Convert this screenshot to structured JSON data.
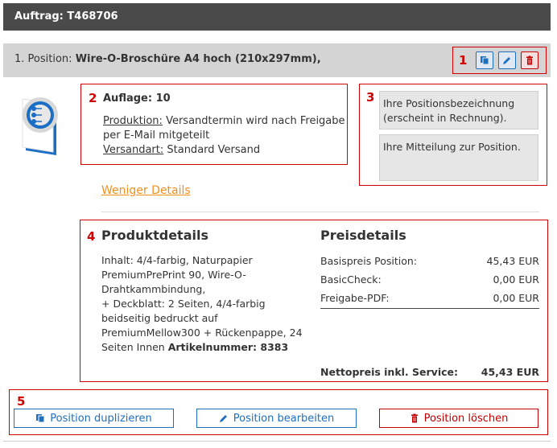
{
  "header": {
    "title": "Auftrag: T468706"
  },
  "position": {
    "prefix": "1. Position:",
    "name": "Wire-O-Broschüre A4 hoch (210x297mm),"
  },
  "annotations": {
    "n1": "1",
    "n2": "2",
    "n3": "3",
    "n4": "4",
    "n5": "5"
  },
  "summary": {
    "auflage": "Auflage: 10",
    "produktion_label": "Produktion:",
    "produktion_value": " Versandtermin wird nach Freigabe",
    "produktion_value2": "per E-Mail mitgeteilt",
    "versandart_label": "Versandart:",
    "versandart_value": " Standard Versand"
  },
  "notes": {
    "position_name_line1": "Ihre Positionsbezeichnung",
    "position_name_line2": "(erscheint in Rechnung).",
    "message": "Ihre Mitteilung zur Position."
  },
  "less_details_link": "Weniger Details",
  "produktdetails": {
    "heading": "Produktdetails",
    "lines": [
      "Inhalt: 4/4-farbig, Naturpapier",
      "PremiumPrePrint 90, Wire-O-",
      "Drahtkammbindung,",
      "+ Deckblatt: 2 Seiten, 4/4-farbig",
      "beidseitig bedruckt auf",
      "PremiumMellow300 + Rückenpappe, 24"
    ],
    "last_line_prefix": "Seiten Innen ",
    "artikel_label": "Artikelnummer: 8383"
  },
  "preisdetails": {
    "heading": "Preisdetails",
    "rows": [
      {
        "label": "Basispreis Position:",
        "value": "45,43 EUR"
      },
      {
        "label": "BasicCheck:",
        "value": "0,00 EUR"
      },
      {
        "label": "Freigabe-PDF:",
        "value": "0,00 EUR"
      }
    ],
    "total_label": "Nettopreis inkl. Service:",
    "total_value": "45,43 EUR"
  },
  "actions": {
    "duplicate": "Position duplizieren",
    "edit": "Position bearbeiten",
    "delete": "Position löschen"
  },
  "colors": {
    "accent": "#1f6fbf",
    "danger": "#c00000",
    "link": "#f0901e",
    "header": "#4a4a4a"
  }
}
